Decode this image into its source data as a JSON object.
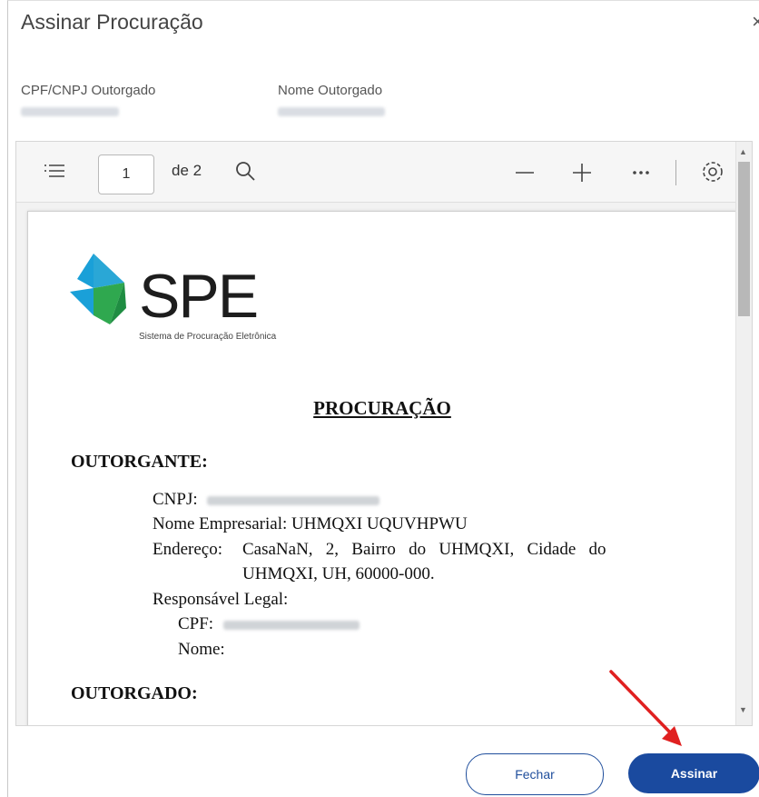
{
  "dialog": {
    "title": "Assinar Procuração",
    "close_symbol": "×"
  },
  "fields": {
    "cpf_label": "CPF/CNPJ Outorgado",
    "name_label": "Nome Outorgado"
  },
  "toolbar": {
    "page_current": "1",
    "page_total_text": "de 2",
    "icons": [
      "list-icon",
      "search-icon",
      "zoom-out-icon",
      "zoom-in-icon",
      "more-icon",
      "settings-icon"
    ]
  },
  "document": {
    "logo_text": "SPE",
    "logo_subtitle": "Sistema de Procuração Eletrônica",
    "title": "PROCURAÇÃO",
    "outorgante_heading": "OUTORGANTE:",
    "cnpj_label": "CNPJ:",
    "nome_empresarial": "Nome Empresarial: UHMQXI UQUVHPWU",
    "endereco_label": "Endereço:",
    "endereco_line1": "CasaNaN,   2,   Bairro   do   UHMQXI,   Cidade   do",
    "endereco_line2": "UHMQXI, UH, 60000-000.",
    "responsavel": "Responsável Legal:",
    "cpf_label": "CPF:",
    "nome_label": "Nome:",
    "outorgado_heading": "OUTORGADO:"
  },
  "buttons": {
    "close_label": "Fechar",
    "sign_label": "Assinar"
  },
  "colors": {
    "primary": "#1a4a9f",
    "annotation_arrow": "#e02020",
    "logo_blue": "#1aa0d8",
    "logo_green": "#2fa84f"
  }
}
